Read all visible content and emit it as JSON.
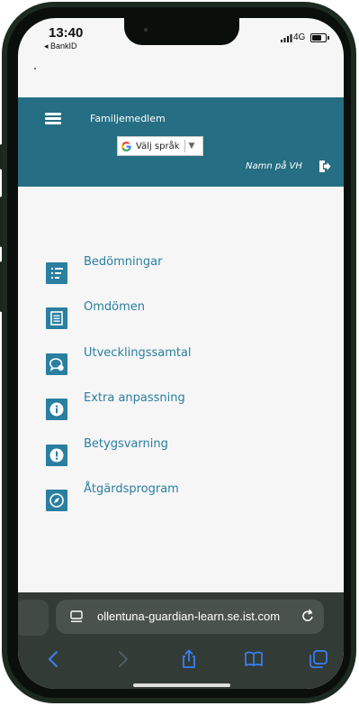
{
  "status_bar": {
    "time": "13:40",
    "back_app": "◂ BankID",
    "network": "4G"
  },
  "header": {
    "title": "Familjemedlem",
    "language_select": "Välj språk",
    "user_name": "Namn på VH"
  },
  "menu": {
    "items": [
      {
        "label": "Bedömningar",
        "icon": "list-icon"
      },
      {
        "label": "Omdömen",
        "icon": "document-icon"
      },
      {
        "label": "Utvecklingssamtal",
        "icon": "chat-icon"
      },
      {
        "label": "Extra anpassning",
        "icon": "info-icon"
      },
      {
        "label": "Betygsvarning",
        "icon": "exclamation-icon"
      },
      {
        "label": "Åtgärdsprogram",
        "icon": "compass-icon"
      }
    ]
  },
  "browser": {
    "url": "ollentuna-guardian-learn.se.ist.com"
  },
  "colors": {
    "header_bg": "#256e83",
    "menu_accent": "#2a7ea0",
    "safari_bar": "#323b35",
    "link_blue": "#3a7ff6"
  }
}
